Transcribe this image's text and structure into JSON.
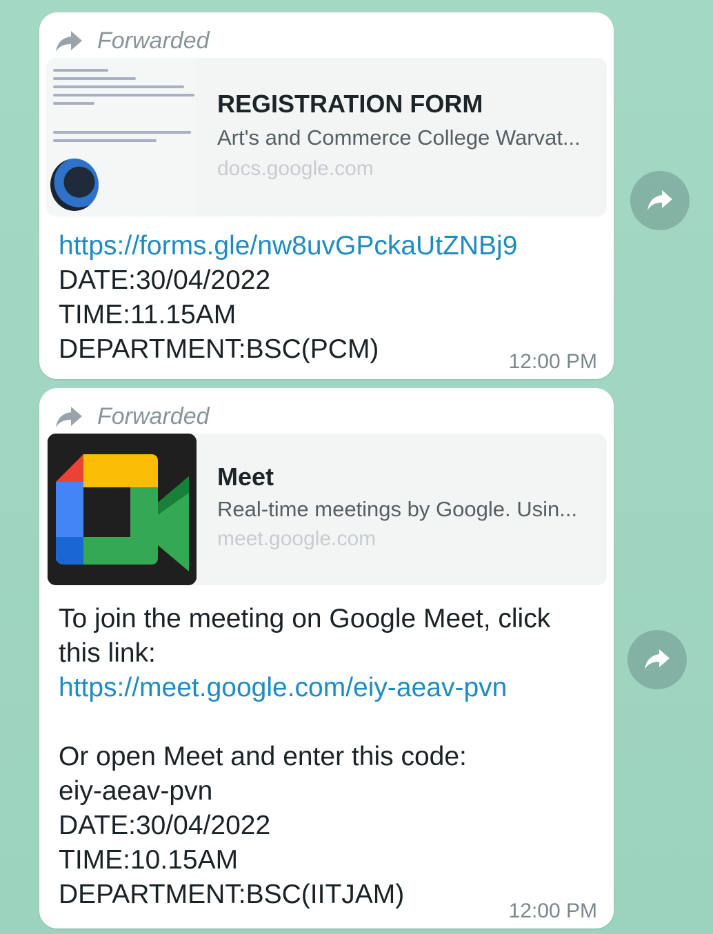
{
  "messages": [
    {
      "forwarded_label": "Forwarded",
      "preview": {
        "title": "REGISTRATION FORM",
        "description": "Art's and Commerce College Warvat...",
        "domain": "docs.google.com",
        "thumbnail_icon": "document-thumbnail"
      },
      "lines": {
        "link": "https://forms.gle/nw8uvGPckaUtZNBj9",
        "date": "DATE:30/04/2022",
        "time": "TIME:11.15AM",
        "department": "DEPARTMENT:BSC(PCM)"
      },
      "timestamp": "12:00 PM"
    },
    {
      "forwarded_label": "Forwarded",
      "preview": {
        "title": "Meet",
        "description": "Real-time meetings by Google. Usin...",
        "domain": "meet.google.com",
        "thumbnail_icon": "google-meet-logo"
      },
      "lines": {
        "intro_1": "To join the meeting on Google Meet, click",
        "intro_2": "this link:",
        "link": "https://meet.google.com/eiy-aeav-pvn",
        "code_prompt": "Or open Meet and enter this code:",
        "code": "eiy-aeav-pvn",
        "date": "DATE:30/04/2022",
        "time": "TIME:10.15AM",
        "department": "DEPARTMENT:BSC(IITJAM)"
      },
      "timestamp": "12:00 PM"
    }
  ],
  "colors": {
    "chat_background": "#9fd6c1",
    "bubble": "#ffffff",
    "link": "#1e8bc3",
    "forwarded_text": "#8a9599"
  },
  "icons": {
    "forwarded": "forward-arrow-icon",
    "share": "share-forward-icon"
  }
}
